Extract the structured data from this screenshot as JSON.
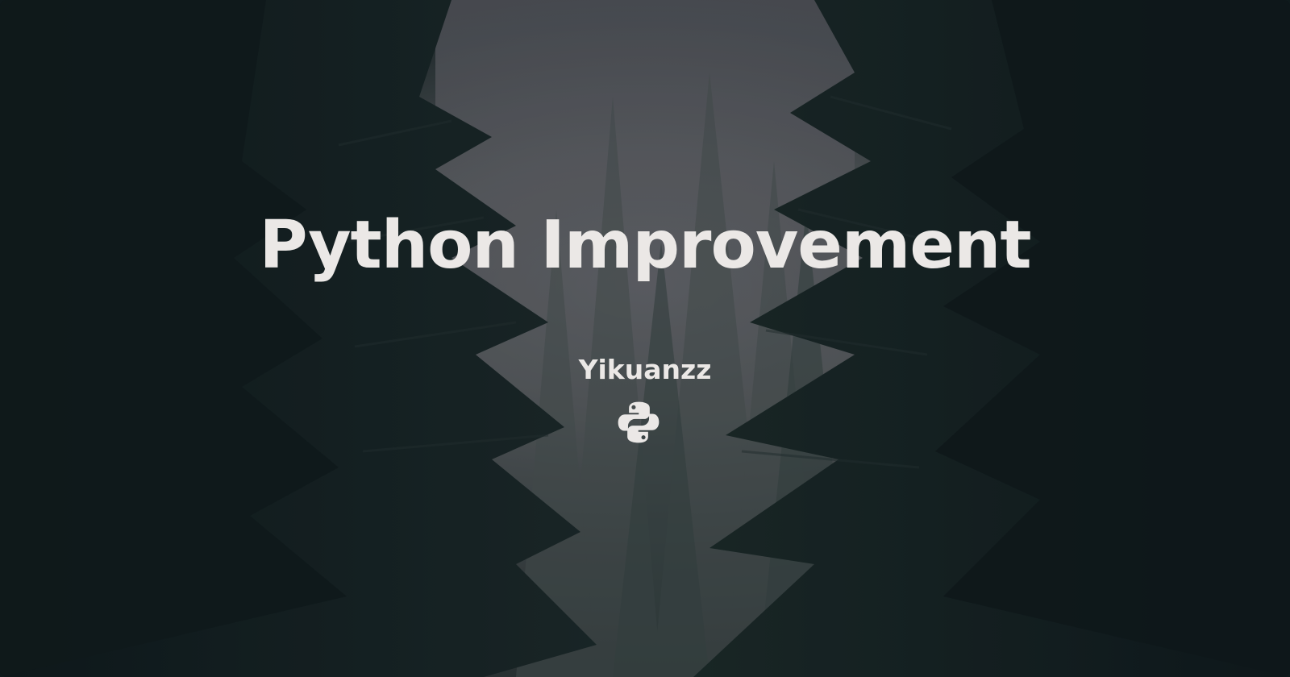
{
  "banner": {
    "title": "Python Improvement",
    "author": "Yikuanzz",
    "logo_icon": "python-logo-icon",
    "text_color": "#ebe8e6",
    "background": "misty pine forest"
  }
}
